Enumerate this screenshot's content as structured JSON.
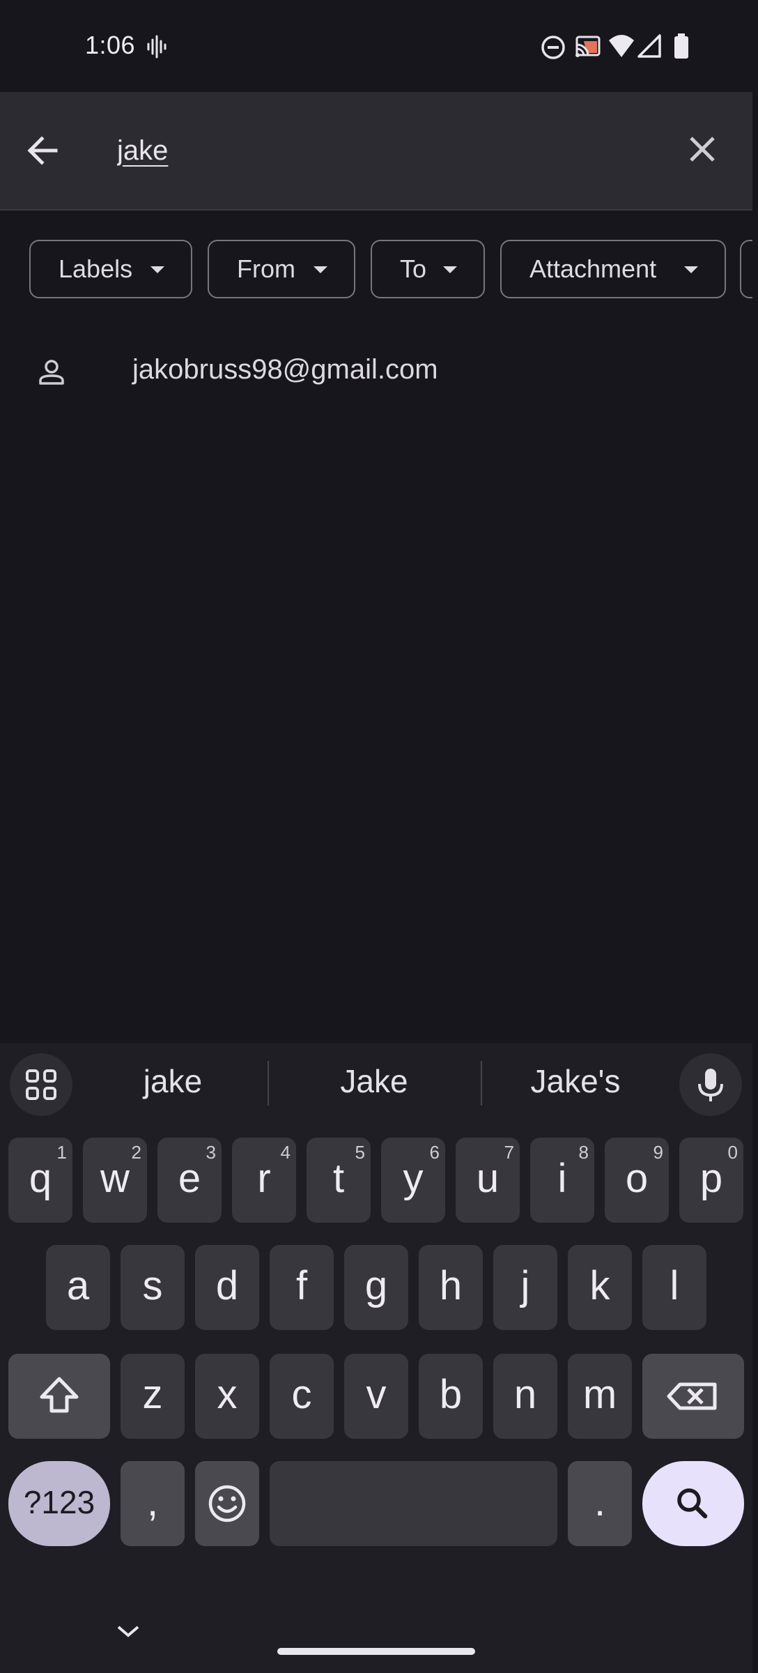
{
  "status_bar": {
    "time": "1:06",
    "icons": [
      "voicemail-wave-icon",
      "do-not-disturb-icon",
      "cast-icon",
      "wifi-icon",
      "signal-icon",
      "battery-icon"
    ]
  },
  "search": {
    "query": "jake",
    "back_icon": "arrow-back-icon",
    "clear_icon": "close-icon"
  },
  "filters": [
    {
      "label": "Labels"
    },
    {
      "label": "From"
    },
    {
      "label": "To"
    },
    {
      "label": "Attachment"
    }
  ],
  "suggestions_list": [
    {
      "icon": "person-icon",
      "text": "jakobruss98@gmail.com"
    }
  ],
  "keyboard": {
    "word_suggestions": [
      "jake",
      "Jake",
      "Jake's"
    ],
    "row1": [
      {
        "k": "q",
        "n": "1"
      },
      {
        "k": "w",
        "n": "2"
      },
      {
        "k": "e",
        "n": "3"
      },
      {
        "k": "r",
        "n": "4"
      },
      {
        "k": "t",
        "n": "5"
      },
      {
        "k": "y",
        "n": "6"
      },
      {
        "k": "u",
        "n": "7"
      },
      {
        "k": "i",
        "n": "8"
      },
      {
        "k": "o",
        "n": "9"
      },
      {
        "k": "p",
        "n": "0"
      }
    ],
    "row2": [
      "a",
      "s",
      "d",
      "f",
      "g",
      "h",
      "j",
      "k",
      "l"
    ],
    "row3": [
      "z",
      "x",
      "c",
      "v",
      "b",
      "n",
      "m"
    ],
    "symbols_label": "?123",
    "comma": ",",
    "period": ".",
    "colors": {
      "search_key": "#e7e1fb",
      "symbols_key": "#bdb8d0"
    }
  }
}
